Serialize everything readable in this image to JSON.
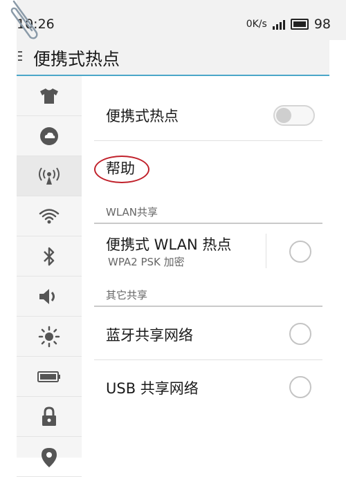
{
  "status_bar": {
    "time": "10:26",
    "net_speed": "0K/s",
    "battery_percent": "98",
    "icons": [
      "signal-icon",
      "battery-icon"
    ]
  },
  "header": {
    "title": "便携式热点",
    "menu_icon": "menu-icon"
  },
  "sidebar": {
    "items": [
      {
        "icon": "shirt-icon"
      },
      {
        "icon": "cloud-icon"
      },
      {
        "icon": "hotspot-icon",
        "active": true
      },
      {
        "icon": "wifi-icon"
      },
      {
        "icon": "bluetooth-icon"
      },
      {
        "icon": "volume-icon"
      },
      {
        "icon": "brightness-icon"
      },
      {
        "icon": "battery-icon"
      },
      {
        "icon": "lock-icon"
      },
      {
        "icon": "location-icon"
      }
    ]
  },
  "main": {
    "hotspot_label": "便携式热点",
    "hotspot_enabled": false,
    "help_label": "帮助",
    "wlan_section_header": "WLAN共享",
    "wlan_hotspot": {
      "label": "便携式 WLAN 热点",
      "subtitle": "WPA2 PSK 加密",
      "selected": false
    },
    "other_section_header": "其它共享",
    "bluetooth_share": {
      "label": "蓝牙共享网络",
      "selected": false
    },
    "usb_share": {
      "label": "USB 共享网络",
      "selected": false
    }
  },
  "colors": {
    "accent_line": "#4aa6c8",
    "annotation_circle": "#c0202a"
  }
}
